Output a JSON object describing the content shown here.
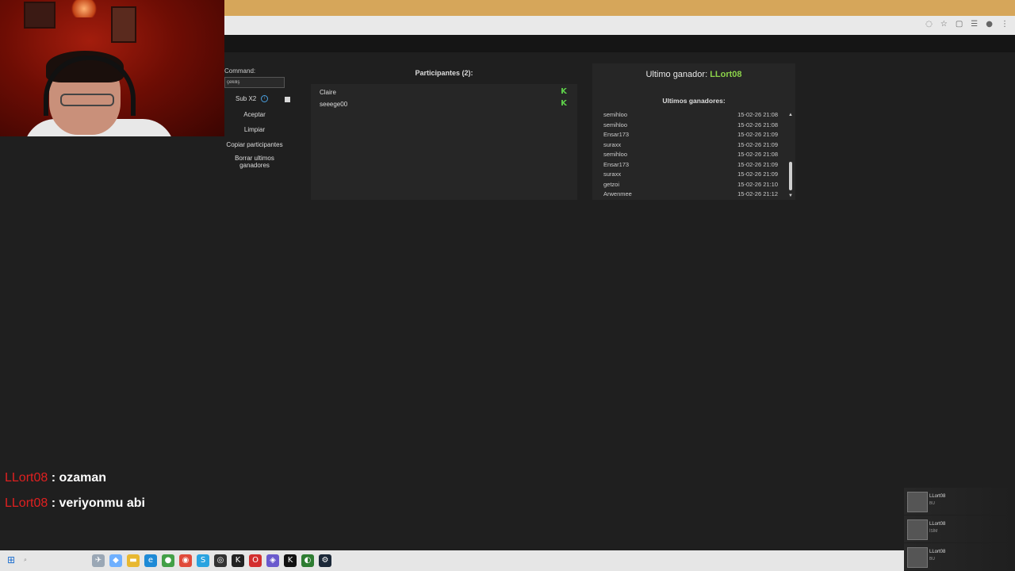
{
  "left_panel": {
    "command_label": "Command:",
    "command_value": "çekiliş",
    "sub_label": "Sub X2",
    "buttons": {
      "aceptar": "Aceptar",
      "limpiar": "Limpiar",
      "copiar": "Copiar participantes",
      "borrar": "Borrar ultimos ganadores"
    }
  },
  "participants": {
    "title": "Participantes (2):",
    "items": [
      {
        "name": "Claire"
      },
      {
        "name": "seeege00"
      }
    ]
  },
  "winners": {
    "last_label": "Ultimo ganador:",
    "last_name": "LLort08",
    "title": "Ultimos ganadores:",
    "list": [
      {
        "name": "semihloo",
        "time": "15-02-26 21:08"
      },
      {
        "name": "semihloo",
        "time": "15-02-26 21:08"
      },
      {
        "name": "Ensar173",
        "time": "15-02-26 21:09"
      },
      {
        "name": "suraxx",
        "time": "15-02-26 21:09"
      },
      {
        "name": "semihloo",
        "time": "15-02-26 21:08"
      },
      {
        "name": "Ensar173",
        "time": "15-02-26 21:09"
      },
      {
        "name": "suraxx",
        "time": "15-02-26 21:09"
      },
      {
        "name": "getzoi",
        "time": "15-02-26 21:10"
      },
      {
        "name": "Arwenmee",
        "time": "15-02-26 21:12"
      }
    ]
  },
  "chat": [
    {
      "user": "LLort08",
      "sep": " : ",
      "msg": "ozaman"
    },
    {
      "user": "LLort08",
      "sep": " : ",
      "msg": "veriyonmu abi"
    }
  ],
  "alerts": [
    {
      "name": "LLort08",
      "sub": "BU"
    },
    {
      "name": "LLort08",
      "sub": "İSİM"
    },
    {
      "name": "LLort08",
      "sub": "BU"
    }
  ],
  "colors": {
    "accent_green": "#8bd24a",
    "chat_user_red": "#e02020",
    "browser_title": "#d6a65a"
  },
  "icons": {
    "kick": "kick-icon",
    "info": "info-icon"
  }
}
